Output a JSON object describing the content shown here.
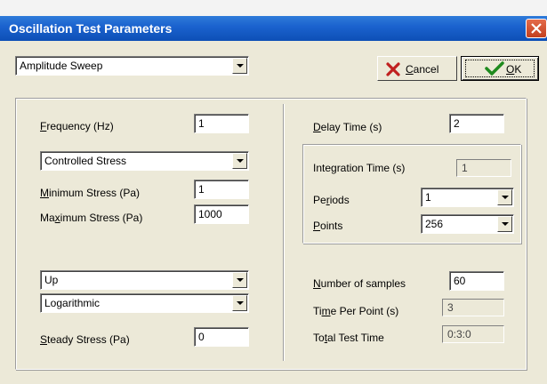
{
  "window": {
    "title": "Oscillation Test Parameters",
    "title_color": "#ffffff",
    "titlebar_color": "#1b63cf"
  },
  "header": {
    "test_type_selected": "Amplitude Sweep",
    "cancel_label_pre": "",
    "cancel_label_mnemonic": "C",
    "cancel_label_post": "ancel",
    "ok_label_pre": "",
    "ok_label_mnemonic": "O",
    "ok_label_post": "K"
  },
  "left": {
    "frequency_label_mnemonic": "F",
    "frequency_label_rest": "requency (Hz)",
    "frequency_value": "1",
    "control_mode_selected": "Controlled Stress",
    "min_stress_label_mnemonic": "M",
    "min_stress_label_rest": "inimum Stress (Pa)",
    "min_stress_value": "1",
    "max_stress_label_pre": "Ma",
    "max_stress_label_mnemonic": "x",
    "max_stress_label_post": "imum Stress (Pa)",
    "max_stress_value": "1000",
    "direction_selected": "Up",
    "scale_selected": "Logarithmic",
    "steady_stress_label_mnemonic": "S",
    "steady_stress_label_rest": "teady Stress (Pa)",
    "steady_stress_value": "0"
  },
  "right": {
    "delay_time_label_mnemonic": "D",
    "delay_time_label_rest": "elay Time (s)",
    "delay_time_value": "2",
    "integration_time_label": "Integration Time (s)",
    "integration_time_value": "1",
    "periods_label_pre": "Pe",
    "periods_label_mnemonic": "r",
    "periods_label_post": "iods",
    "periods_selected": "1",
    "points_label_mnemonic": "P",
    "points_label_rest": "oints",
    "points_selected": "256",
    "samples_label_mnemonic": "N",
    "samples_label_rest": "umber of samples",
    "samples_value": "60",
    "time_per_point_label_pre": "Ti",
    "time_per_point_label_mnemonic": "m",
    "time_per_point_label_post": "e Per Point (s)",
    "time_per_point_value": "3",
    "total_time_label_pre": "To",
    "total_time_label_mnemonic": "t",
    "total_time_label_post": "al Test Time",
    "total_time_value": "0:3:0"
  },
  "icons": {
    "close": "close-icon",
    "cancel": "red-x-icon",
    "ok": "green-check-icon",
    "dropdown": "chevron-down-icon"
  },
  "colors": {
    "dialog_bg": "#ece9d8",
    "cancel_x": "#c0201f",
    "ok_check": "#1e8a1e"
  }
}
